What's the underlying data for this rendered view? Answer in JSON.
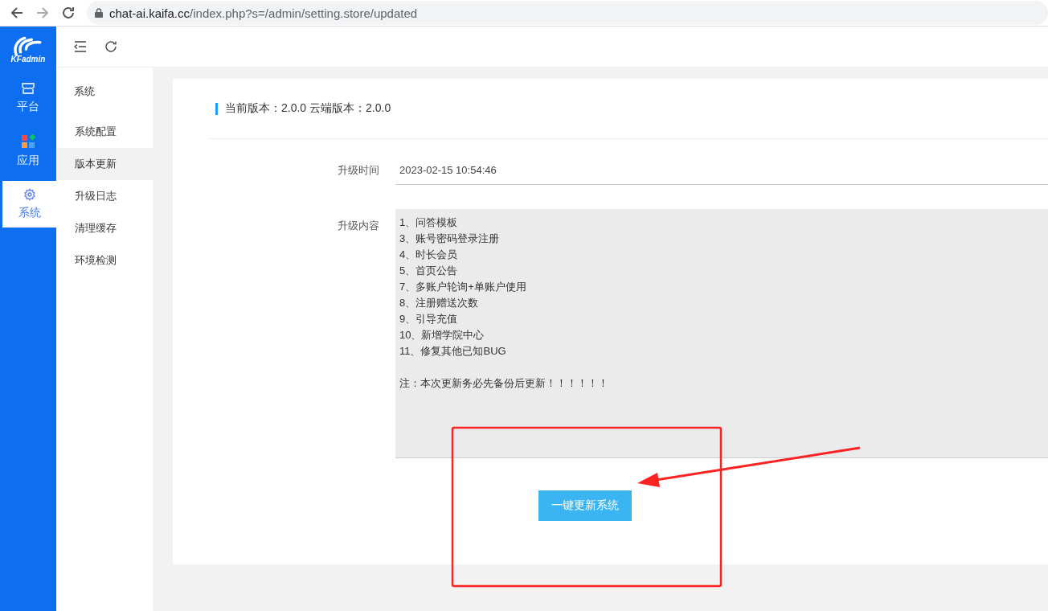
{
  "browser": {
    "url_host": "chat-ai.kaifa.cc",
    "url_path": "/index.php?s=/admin/setting.store/updated"
  },
  "logo": {
    "text": "KFadmin"
  },
  "rail": [
    {
      "label": "平台",
      "kind": "store",
      "selected": false
    },
    {
      "label": "应用",
      "kind": "apps",
      "selected": false
    },
    {
      "label": "系统",
      "kind": "gear",
      "selected": true
    }
  ],
  "submenu": {
    "title": "系统",
    "items": [
      {
        "label": "系统配置",
        "selected": false
      },
      {
        "label": "版本更新",
        "selected": true
      },
      {
        "label": "升级日志",
        "selected": false
      },
      {
        "label": "清理缓存",
        "selected": false
      },
      {
        "label": "环境检测",
        "selected": false
      }
    ]
  },
  "card": {
    "heading": "当前版本：2.0.0 云端版本：2.0.0",
    "time_label": "升级时间",
    "time_value": "2023-02-15 10:54:46",
    "content_label": "升级内容",
    "content_lines": [
      "1、问答模板",
      "3、账号密码登录注册",
      "4、时长会员",
      "5、首页公告",
      "7、多账户轮询+单账户使用",
      "8、注册赠送次数",
      "9、引导充值",
      "10、新增学院中心",
      "11、修复其他已知BUG"
    ],
    "note": "注：本次更新务必先备份后更新！！！！！！",
    "button": "一键更新系统"
  }
}
